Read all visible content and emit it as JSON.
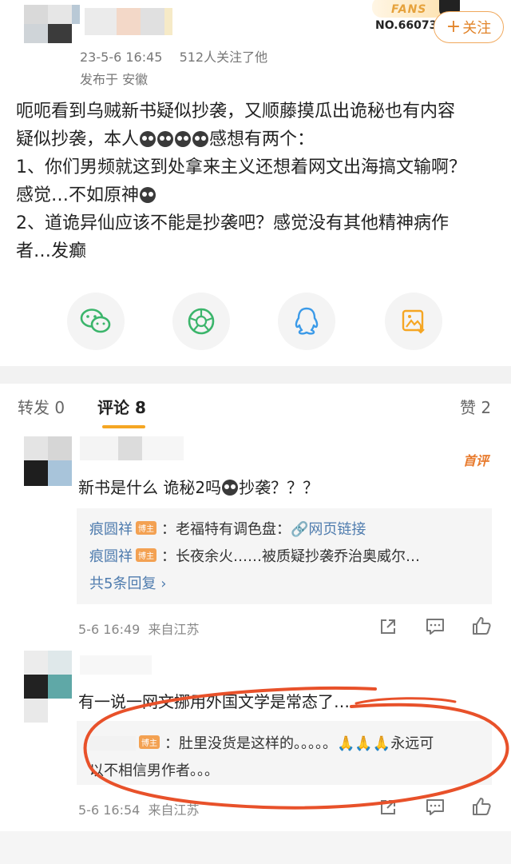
{
  "post": {
    "timestamp": "23-5-6 16:45",
    "followers": "512人关注了他",
    "location": "发布于 安徽",
    "fans_word": "FANS",
    "fans_number": "NO.66073",
    "follow_label": "关注",
    "follow_plus": "+",
    "text": {
      "l1": "呃呃看到乌贼新书疑似抄袭，又顺藤摸瓜出诡秘也有内容",
      "l2a": "疑似抄袭，本人",
      "l2b": "感想有两个：",
      "l3": "1、你们男频就这到处拿来主义还想着网文出海搞文输啊？",
      "l4": "感觉…不如原神",
      "l5": "2、道诡异仙应该不能是抄袭吧？感觉没有其他精神病作",
      "l6": "者…发癫"
    },
    "share_icons": [
      "wechat-icon",
      "moments-icon",
      "qq-icon",
      "save-image-icon"
    ]
  },
  "tabs": {
    "repost": "转发 0",
    "comments": "评论 8",
    "likes": "赞 2"
  },
  "comments": [
    {
      "text_a": "新书是什么 诡秘2吗",
      "text_b": "抄袭？？？",
      "badge": "首评",
      "replies": [
        {
          "user": "痕圆祥",
          "tag": "博主",
          "sep": "：",
          "text": "老福特有调色盘：",
          "link_icon": "🔗",
          "link": "网页链接"
        },
        {
          "user": "痕圆祥",
          "tag": "博主",
          "sep": "：",
          "text": "长夜余火……被质疑抄袭乔治奥威尔…"
        }
      ],
      "more": "共5条回复",
      "more_arrow": "›",
      "time": "5-6 16:49",
      "source": "来自江苏"
    },
    {
      "text": "有一说一网文挪用外国文学是常态了……",
      "reply_tag": "博主",
      "reply_l1": "：肚里没货是这样的。。。。。🙏🙏🙏永远可",
      "reply_l2": "以不相信男作者。。。",
      "time": "5-6 16:54",
      "source": "来自江苏"
    }
  ],
  "colors": {
    "accent_orange": "#f5a623",
    "link_blue": "#4f7cae",
    "annotation_red": "#e8512a"
  }
}
